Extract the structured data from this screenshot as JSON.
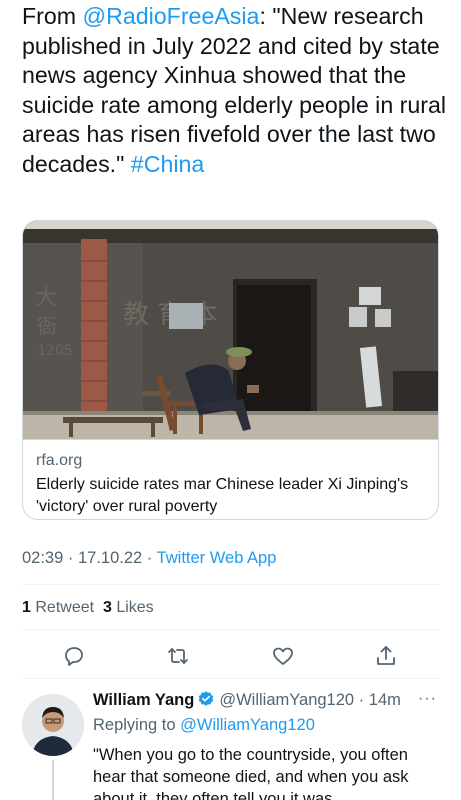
{
  "tweet": {
    "prefix": "From ",
    "mention": "@RadioFreeAsia",
    "body": ": \"New research published in July 2022 and cited by state news agency Xinhua showed that the suicide rate among elderly people in rural areas has risen fivefold over the last two decades.\" ",
    "hashtag": "#China"
  },
  "card": {
    "domain": "rfa.org",
    "title": "Elderly suicide rates mar Chinese leader Xi Jinping's 'victory' over rural poverty"
  },
  "meta": {
    "time": "02:39",
    "separator": " · ",
    "date": "17.10.22",
    "source": "Twitter Web App"
  },
  "stats": {
    "retweets_count": "1",
    "retweets_label": "Retweet",
    "likes_count": "3",
    "likes_label": "Likes"
  },
  "icons": [
    "reply-icon",
    "retweet-icon",
    "like-icon",
    "share-icon",
    "verified-badge-icon",
    "more-icon"
  ],
  "reply": {
    "name": "William Yang",
    "handle": "@WilliamYang120",
    "separator": " · ",
    "time": "14m",
    "more": "···",
    "replying_to_label": "Replying to ",
    "replying_to_handle": "@WilliamYang120",
    "text": "\"When you go to the countryside, you often hear that someone died, and when you ask about it, they often tell you it was"
  },
  "colors": {
    "accent": "#1d9bf0",
    "text": "#0f1419",
    "secondary": "#536471",
    "border": "#cfd9de"
  }
}
